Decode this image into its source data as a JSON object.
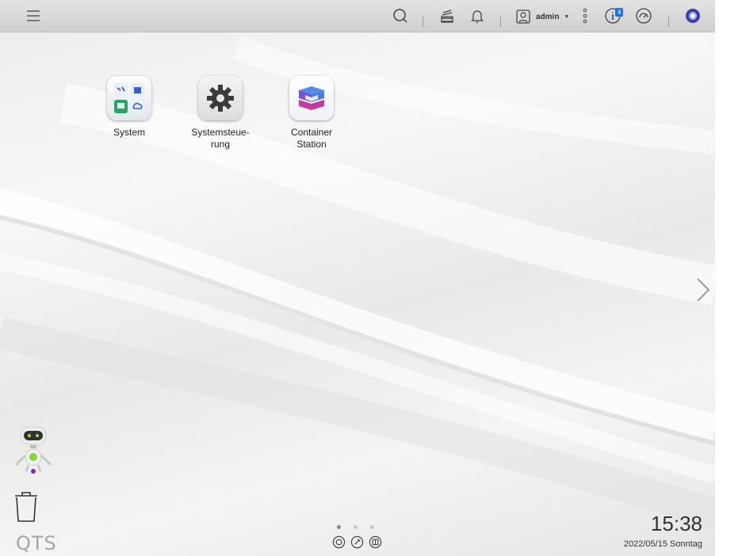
{
  "topbar": {
    "user_name": "admin",
    "notification_badge": "4",
    "icons": [
      "menu-icon",
      "search-icon",
      "background-tasks-icon",
      "notifications-icon",
      "user-icon",
      "more-options-icon",
      "info-icon",
      "dashboard-icon",
      "myqnapcloud-icon"
    ]
  },
  "apps": [
    {
      "label": "System",
      "icon": "system-folder-icon"
    },
    {
      "label": "Systemsteue-\nrung",
      "icon": "gear-icon"
    },
    {
      "label": "Container\nStation",
      "icon": "container-station-icon"
    }
  ],
  "desktop": {
    "logo": "QTS",
    "time": "15:38",
    "date": "2022/05/15 Sonntag",
    "pages": 3,
    "active_page": 1
  },
  "colors": {
    "accent": "#1e6fe0",
    "topbar": "#d9d9d9",
    "text": "#222222"
  }
}
